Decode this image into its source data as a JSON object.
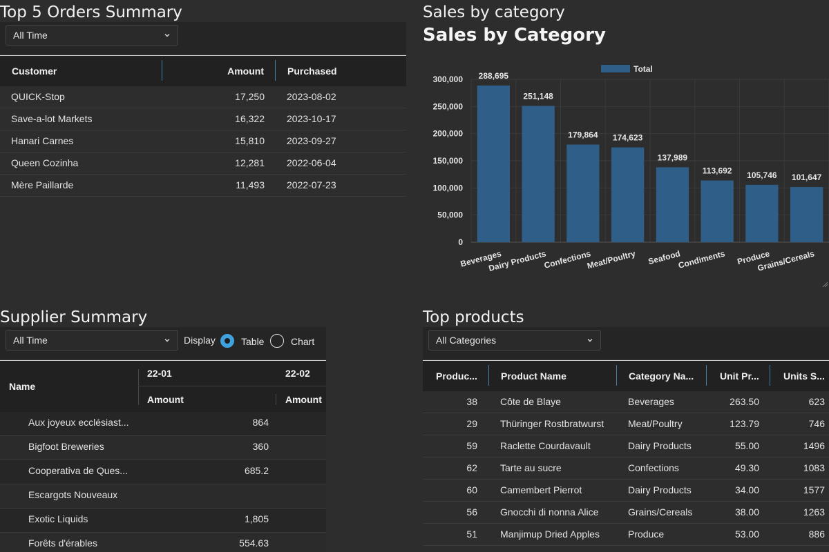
{
  "orders": {
    "title": "Top 5 Orders Summary",
    "filter": "All Time",
    "columns": [
      "Customer",
      "Amount",
      "Purchased"
    ],
    "rows": [
      [
        "QUICK-Stop",
        "17,250",
        "2023-08-02"
      ],
      [
        "Save-a-lot Markets",
        "16,322",
        "2023-10-17"
      ],
      [
        "Hanari Carnes",
        "15,810",
        "2023-09-27"
      ],
      [
        "Queen Cozinha",
        "12,281",
        "2022-06-04"
      ],
      [
        "Mère Paillarde",
        "11,493",
        "2022-07-23"
      ]
    ]
  },
  "sales": {
    "panel_title": "Sales by category"
  },
  "chart_data": {
    "type": "bar",
    "title": "Sales by Category",
    "categories": [
      "Beverages",
      "Dairy Products",
      "Confections",
      "Meat/Poultry",
      "Seafood",
      "Condiments",
      "Produce",
      "Grains/Cereals"
    ],
    "series": [
      {
        "name": "Total",
        "values": [
          288695,
          251148,
          179864,
          174623,
          137989,
          113692,
          105746,
          101647
        ]
      }
    ],
    "value_labels": [
      "288,695",
      "251,148",
      "179,864",
      "174,623",
      "137,989",
      "113,692",
      "105,746",
      "101,647"
    ],
    "yticks": [
      "0",
      "50,000",
      "100,000",
      "150,000",
      "200,000",
      "250,000",
      "300,000"
    ],
    "ylim": [
      0,
      300000
    ],
    "legend": "top-center",
    "grid": true,
    "bar_color": "#2f5f88"
  },
  "suppliers": {
    "title": "Supplier Summary",
    "filter": "All Time",
    "display_label": "Display",
    "display_options": [
      "Table",
      "Chart"
    ],
    "display_selected": "Table",
    "name_header": "Name",
    "periods": [
      "22-01",
      "22-02"
    ],
    "sub_header": "Amount",
    "rows": [
      [
        "Aux joyeux ecclésiast...",
        "864"
      ],
      [
        "Bigfoot Breweries",
        "360"
      ],
      [
        "Cooperativa de Ques...",
        "685.2"
      ],
      [
        "Escargots Nouveaux",
        ""
      ],
      [
        "Exotic Liquids",
        "1,805"
      ],
      [
        "Forêts d'érables",
        "554.63"
      ]
    ]
  },
  "products": {
    "title": "Top products",
    "filter": "All Categories",
    "columns": [
      "Produc...",
      "Product Name",
      "Category Na...",
      "Unit Pr...",
      "Units S..."
    ],
    "rows": [
      [
        "38",
        "Côte de Blaye",
        "Beverages",
        "263.50",
        "623"
      ],
      [
        "29",
        "Thüringer Rostbratwurst",
        "Meat/Poultry",
        "123.79",
        "746"
      ],
      [
        "59",
        "Raclette Courdavault",
        "Dairy Products",
        "55.00",
        "1496"
      ],
      [
        "62",
        "Tarte au sucre",
        "Confections",
        "49.30",
        "1083"
      ],
      [
        "60",
        "Camembert Pierrot",
        "Dairy Products",
        "34.00",
        "1577"
      ],
      [
        "56",
        "Gnocchi di nonna Alice",
        "Grains/Cereals",
        "38.00",
        "1263"
      ],
      [
        "51",
        "Manjimup Dried Apples",
        "Produce",
        "53.00",
        "886"
      ]
    ]
  },
  "icons": {
    "dropdown": "chevron-down-icon",
    "resize": "resize-grip-icon"
  },
  "colors": {
    "background": "#2d2d2d",
    "accent": "#3fa3e0",
    "bar": "#2f5f88"
  }
}
